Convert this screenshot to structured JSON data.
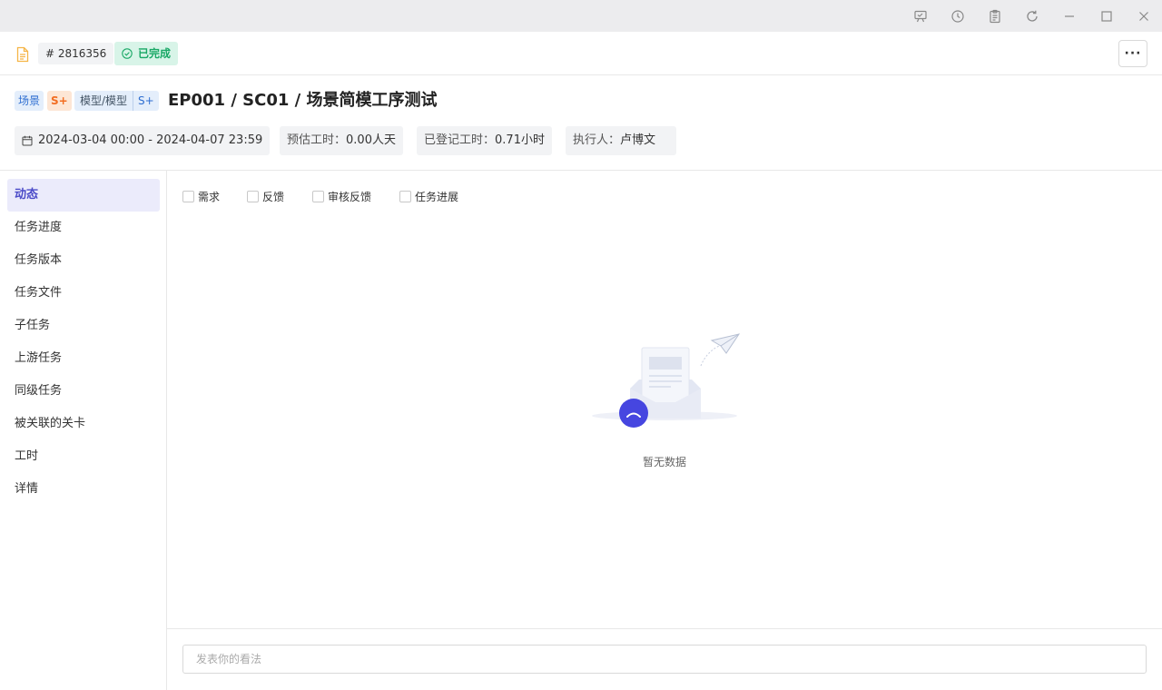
{
  "window": {
    "icons": [
      "presentation-icon",
      "history-icon",
      "clipboard-icon",
      "refresh-icon",
      "minimize-icon",
      "maximize-icon",
      "close-icon"
    ]
  },
  "task": {
    "id": "# 2816356",
    "status": "已完成",
    "tags": {
      "scene": "场景",
      "level": "S+",
      "model": "模型/模型",
      "model_level": "S+"
    },
    "title": "EP001 / SC01 / 场景简模工序测试",
    "date_range": "2024-03-04 00:00 - 2024-04-07 23:59",
    "estimate_label": "预估工时：",
    "estimate_value": "0.00人天",
    "logged_label": "已登记工时：",
    "logged_value": "0.71小时",
    "assignee_label": "执行人：",
    "assignee_value": "卢博文"
  },
  "sidebar": {
    "items": [
      {
        "label": "动态",
        "active": true
      },
      {
        "label": "任务进度"
      },
      {
        "label": "任务版本"
      },
      {
        "label": "任务文件"
      },
      {
        "label": "子任务"
      },
      {
        "label": "上游任务"
      },
      {
        "label": "同级任务"
      },
      {
        "label": "被关联的关卡"
      },
      {
        "label": "工时"
      },
      {
        "label": "详情"
      }
    ]
  },
  "filters": [
    {
      "label": "需求",
      "checked": false
    },
    {
      "label": "反馈",
      "checked": false
    },
    {
      "label": "审核反馈",
      "checked": false
    },
    {
      "label": "任务进展",
      "checked": false
    }
  ],
  "empty_state": {
    "text": "暂无数据"
  },
  "comment": {
    "placeholder": "发表你的看法"
  },
  "colors": {
    "accent": "#4a4ac8",
    "success": "#19a866",
    "empty_face": "#4646e0"
  }
}
